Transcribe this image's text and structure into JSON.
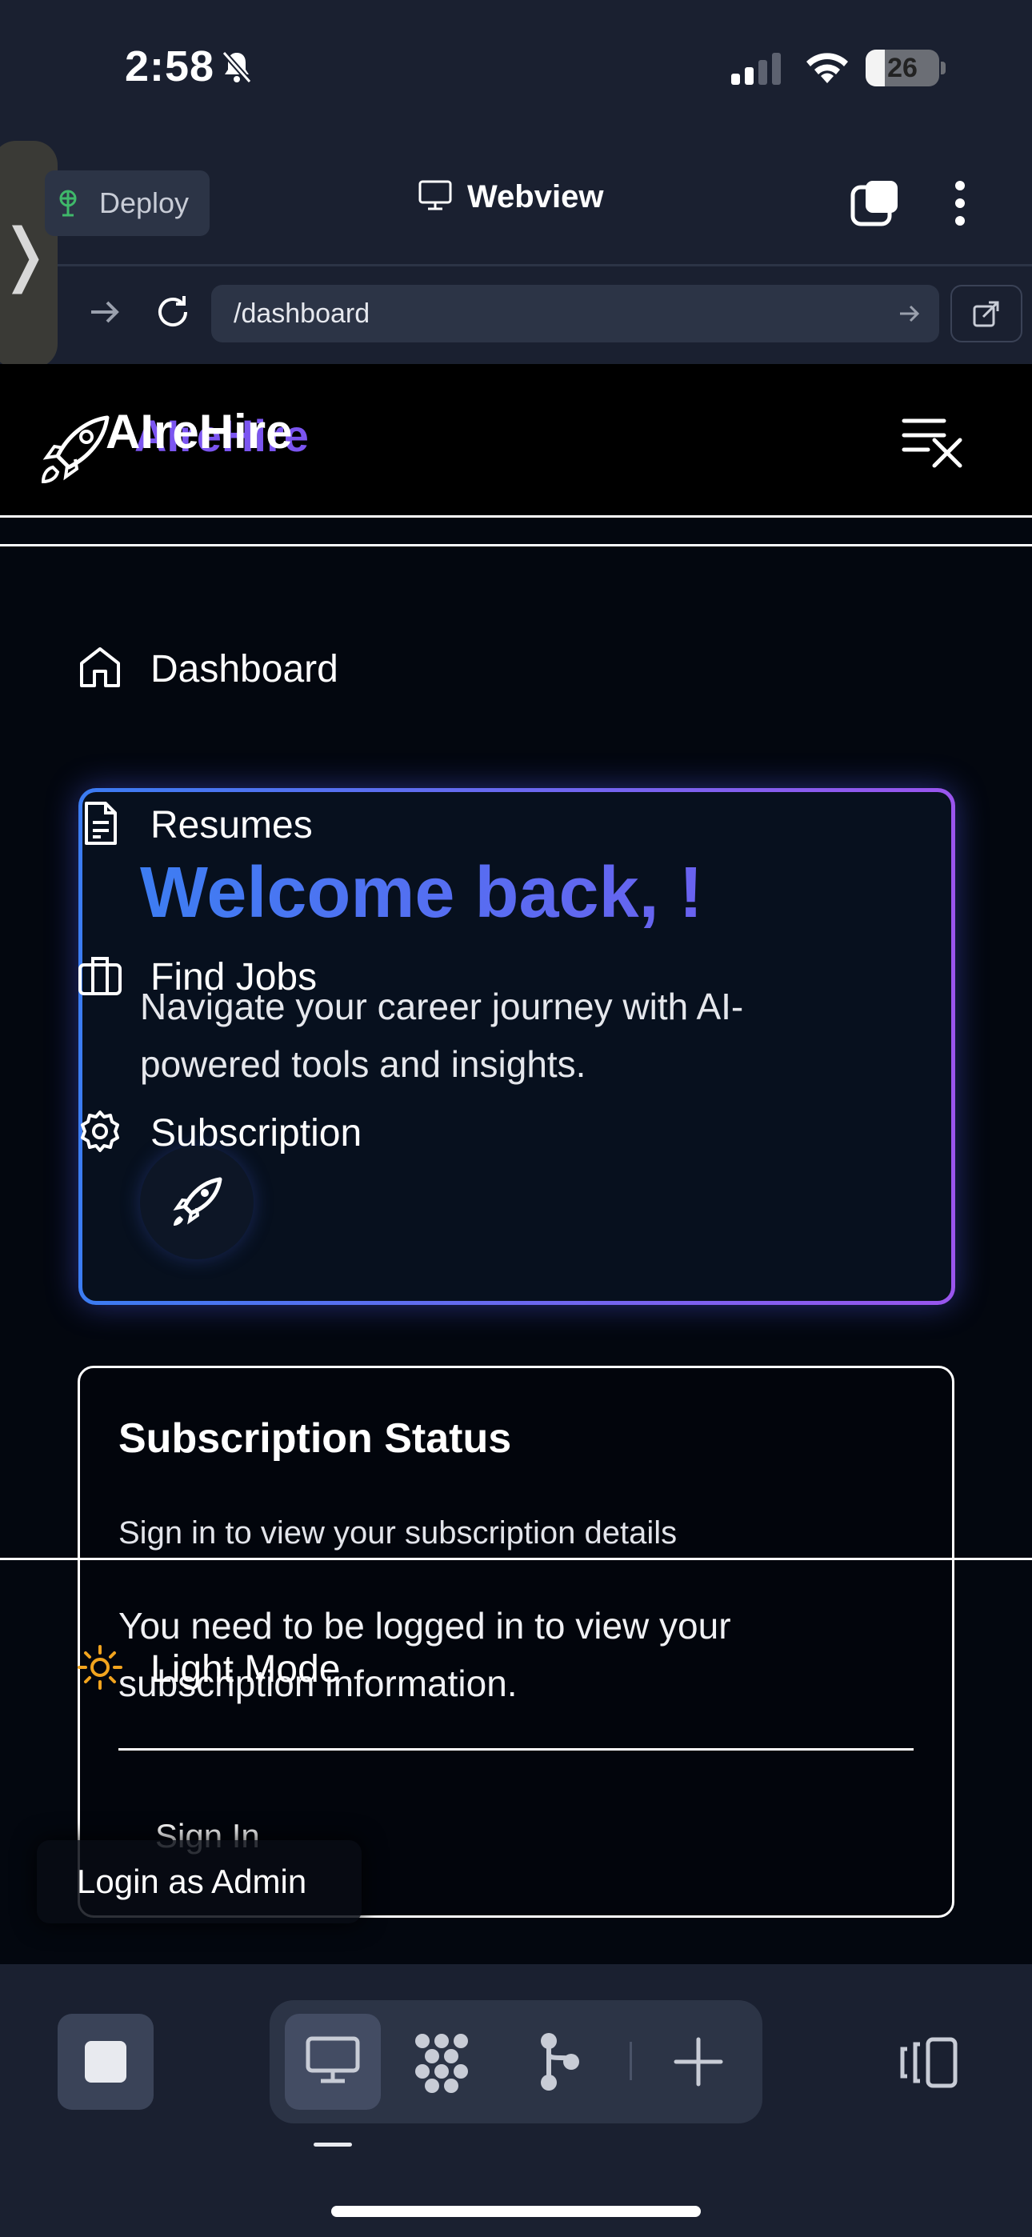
{
  "status_bar": {
    "time": "2:58",
    "battery": "26",
    "battery_level": 0.26
  },
  "browser": {
    "deploy_label": "Deploy",
    "title": "Webview",
    "url": "/dashboard"
  },
  "app": {
    "brand": "AIreHire",
    "brand_ghost": "AIreHire"
  },
  "nav": {
    "dashboard": "Dashboard",
    "resumes": "Resumes",
    "find_jobs": "Find Jobs",
    "subscription": "Subscription",
    "light_mode": "Light Mode",
    "login_admin": "Login as Admin"
  },
  "welcome": {
    "title": "Welcome back, !",
    "subtitle": "Navigate your career journey with AI-powered tools and insights."
  },
  "subscription_card": {
    "title": "Subscription Status",
    "description": "Sign in to view your subscription details",
    "message": "You need to be logged in to view your subscription information.",
    "sign_in": "Sign In"
  },
  "colors": {
    "accent_blue": "#3d7df2",
    "accent_purple": "#9a55ee",
    "background": "#03070f",
    "chrome": "#1a2030"
  }
}
